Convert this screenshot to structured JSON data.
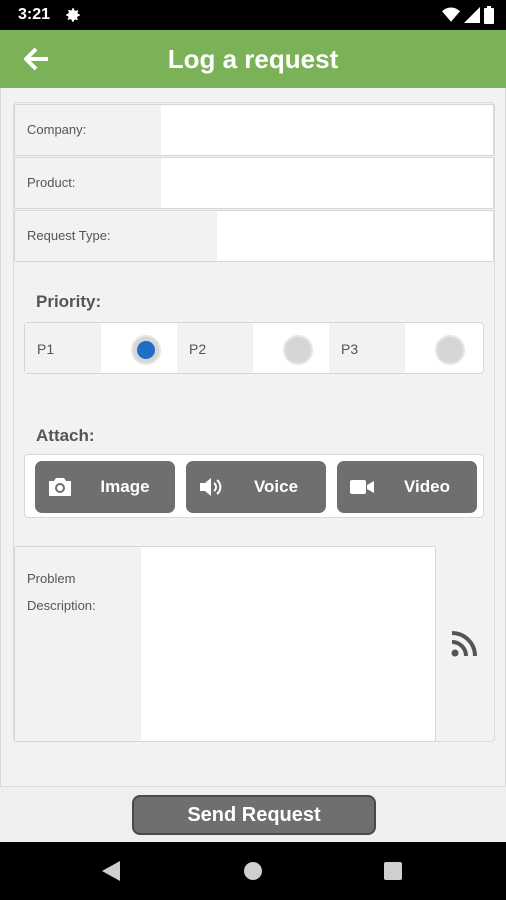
{
  "status_bar": {
    "time": "3:21"
  },
  "app_bar": {
    "title": "Log a request"
  },
  "form": {
    "company_label": "Company:",
    "product_label": "Product:",
    "request_type_label": "Request Type:",
    "priority_label": "Priority:",
    "priority_options": [
      "P1",
      "P2",
      "P3"
    ],
    "selected_priority": "P1",
    "attach_label": "Attach:",
    "attach_buttons": {
      "image": "Image",
      "voice": "Voice",
      "video": "Video"
    },
    "problem_label_line1": "Problem",
    "problem_label_line2": "Description:"
  },
  "send_button": "Send Request",
  "colors": {
    "app_bar": "#7cb257",
    "radio_selected": "#1e6fc3",
    "button": "#6f6f6f"
  },
  "icons": {
    "status": [
      "gear-icon",
      "wifi-icon",
      "signal-icon",
      "battery-icon"
    ],
    "app_bar": "back-arrow-icon",
    "attach": [
      "camera-icon",
      "speaker-icon",
      "video-camera-icon"
    ],
    "description": "rss-icon",
    "nav": [
      "nav-back-icon",
      "nav-home-icon",
      "nav-recents-icon"
    ]
  }
}
